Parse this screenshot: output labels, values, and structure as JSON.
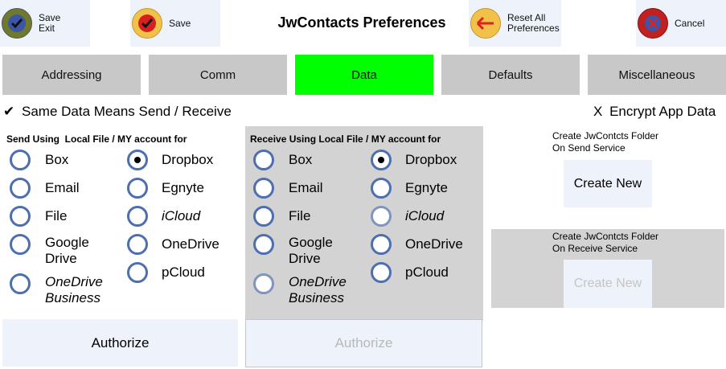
{
  "header": {
    "title": "JwContacts Preferences",
    "save_exit_label": "Save\nExit",
    "save_label": "Save",
    "reset_label": "Reset All\nPreferences",
    "cancel_label": "Cancel"
  },
  "tabs": [
    "Addressing",
    "Comm",
    "Data",
    "Defaults",
    "Miscellaneous"
  ],
  "options": {
    "same_data_mark": "✔",
    "same_data_label": "Same Data Means Send / Receive",
    "encrypt_mark": "X",
    "encrypt_label": "Encrypt App Data"
  },
  "send": {
    "heading": "Send Using  Local File / MY account for",
    "left": [
      "Box",
      "Email",
      "File",
      "Google\nDrive",
      "OneDrive\nBusiness"
    ],
    "right": [
      "Dropbox",
      "Egnyte",
      "iCloud",
      "OneDrive",
      "pCloud"
    ],
    "authorize": "Authorize"
  },
  "receive": {
    "heading": "Receive Using Local File / MY account for",
    "left": [
      "Box",
      "Email",
      "File",
      "Google\nDrive",
      "OneDrive\nBusiness"
    ],
    "right": [
      "Dropbox",
      "Egnyte",
      "iCloud",
      "OneDrive",
      "pCloud"
    ],
    "authorize": "Authorize"
  },
  "folders": {
    "send_text": "Create JwContcts Folder\nOn Send Service",
    "send_button": "Create New",
    "receive_text": "Create JwContcts Folder\nOn Receive Service",
    "receive_button": "Create New"
  },
  "colors": {
    "active_tab": "#00ff00",
    "tab": "#c8c8c8",
    "radio_ring": "#4d6fb0",
    "panel": "#d3d3d3"
  }
}
